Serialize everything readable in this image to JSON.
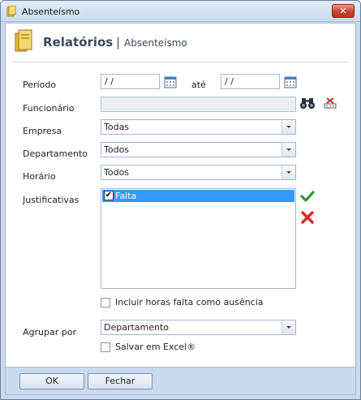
{
  "window": {
    "title": "Absenteísmo",
    "close_glyph": "✕"
  },
  "header": {
    "title": "Relatórios",
    "separator": "|",
    "subtitle": "Absenteísmo"
  },
  "form": {
    "periodo_label": "Período",
    "periodo_start": " /  /",
    "ate_label": "até",
    "periodo_end": " /  /",
    "funcionario_label": "Funcionário",
    "funcionario_value": "",
    "empresa_label": "Empresa",
    "empresa_value": "Todas",
    "departamento_label": "Departamento",
    "departamento_value": "Todos",
    "horario_label": "Horário",
    "horario_value": "Todos",
    "justificativas_label": "Justificativas",
    "justificativas_items": [
      {
        "label": "Falta",
        "checked": true,
        "check_glyph": "✔"
      }
    ],
    "incluir_label": "Incluir horas falta como ausência",
    "agrupar_label": "Agrupar por",
    "agrupar_value": "Departamento",
    "excel_label": "Salvar em Excel®"
  },
  "buttons": {
    "ok": "OK",
    "cancel": "Fechar"
  },
  "icons": {
    "calendar": "calendar-icon",
    "search": "binoculars-icon",
    "clear": "eraser-icon",
    "check_all": "green-check-icon",
    "uncheck_all": "red-x-icon"
  },
  "colors": {
    "selection": "#3399ff",
    "titlebar": "#cbdaee",
    "close": "#c9442c"
  }
}
